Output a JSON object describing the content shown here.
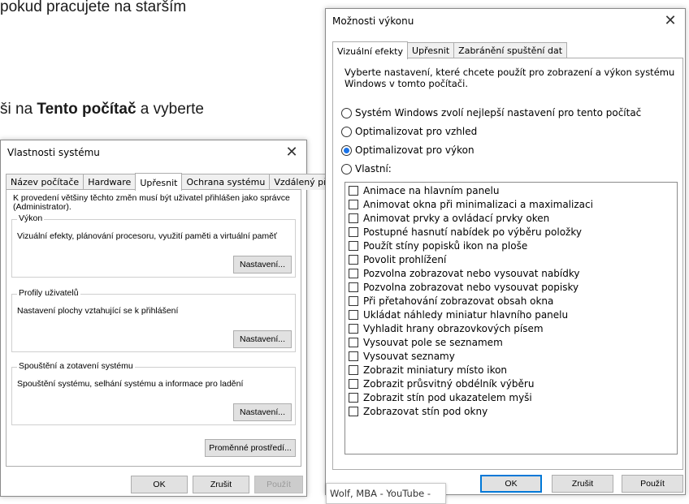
{
  "document": {
    "line1": "pokud pracujete na starším",
    "line2_prefix": "ši na ",
    "line2_bold": "Tento počítač",
    "line2_suffix": " a vyberte"
  },
  "system_properties": {
    "title": "Vlastnosti systému",
    "close": "✕",
    "tabs": [
      "Název počítače",
      "Hardware",
      "Upřesnit",
      "Ochrana systému",
      "Vzdálený přístup"
    ],
    "active_tab": "Upřesnit",
    "admin_note": "K provedení většiny těchto změn musí být uživatel přihlášen jako správce (Administrator).",
    "groups": [
      {
        "label": "Výkon",
        "text": "Vizuální efekty, plánování procesoru, využití paměti a virtuální paměť",
        "button": "Nastavení..."
      },
      {
        "label": "Profily uživatelů",
        "text": "Nastavení plochy vztahující se k přihlášení",
        "button": "Nastavení..."
      },
      {
        "label": "Spouštění a zotavení systému",
        "text": "Spouštění systému, selhání systému a informace pro ladění",
        "button": "Nastavení..."
      }
    ],
    "env_button": "Proměnné prostředí...",
    "ok": "OK",
    "cancel": "Zrušit",
    "apply": "Použít"
  },
  "performance_options": {
    "title": "Možnosti výkonu",
    "close": "✕",
    "tabs": [
      "Vizuální efekty",
      "Upřesnit",
      "Zabránění spuštění dat"
    ],
    "active_tab": "Vizuální efekty",
    "description": "Vyberte nastavení, které chcete použít pro zobrazení a výkon systému Windows v tomto počítači.",
    "radios": [
      {
        "label": "Systém Windows zvolí nejlepší nastavení pro tento počítač",
        "checked": false
      },
      {
        "label": "Optimalizovat pro vzhled",
        "checked": false
      },
      {
        "label": "Optimalizovat pro výkon",
        "checked": true
      },
      {
        "label": "Vlastní:",
        "checked": false
      }
    ],
    "checkboxes": [
      "Animace na hlavním panelu",
      "Animovat okna při minimalizaci a maximalizaci",
      "Animovat prvky a ovládací prvky oken",
      "Postupné hasnutí nabídek po výběru položky",
      "Použít stíny popisků ikon na ploše",
      "Povolit prohlížení",
      "Pozvolna zobrazovat nebo vysouvat nabídky",
      "Pozvolna zobrazovat nebo vysouvat popisky",
      "Při přetahování zobrazovat obsah okna",
      "Ukládat náhledy miniatur hlavního panelu",
      "Vyhladit hrany obrazovkových písem",
      "Vysouvat pole se seznamem",
      "Vysouvat seznamy",
      "Zobrazit miniatury místo ikon",
      "Zobrazit průsvitný obdélník výběru",
      "Zobrazit stín pod ukazatelem myši",
      "Zobrazovat stín pod okny"
    ],
    "ok": "OK",
    "cancel": "Zrušit",
    "apply": "Použít"
  },
  "youtube_overlay": "Wolf, MBA - YouTube -"
}
